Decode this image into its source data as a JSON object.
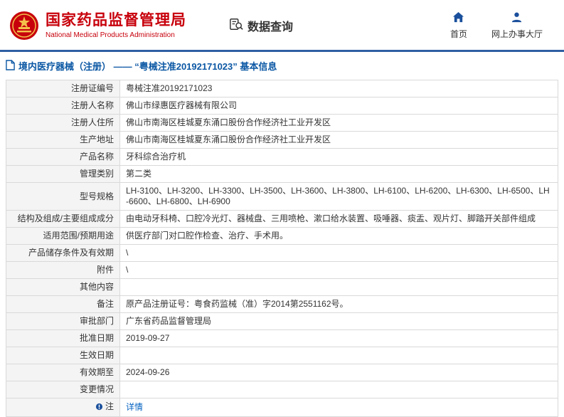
{
  "colors": {
    "brand_red": "#c7000b",
    "divider_blue": "#2e5fa3",
    "breadcrumb_blue": "#0b57a4",
    "link_blue": "#0563c1",
    "nav_icon_blue": "#1a4f9c"
  },
  "header": {
    "agency_name_cn": "国家药品监督管理局",
    "agency_name_en": "National Medical Products Administration",
    "section_title": "数据查询",
    "nav": [
      {
        "label": "首页",
        "icon": "home-icon"
      },
      {
        "label": "网上办事大厅",
        "icon": "person-icon"
      }
    ]
  },
  "breadcrumb": {
    "text": "境内医疗器械（注册） —— “粤械注准20192171023” 基本信息"
  },
  "table": {
    "rows": [
      {
        "label": "注册证编号",
        "value": "粤械注准20192171023"
      },
      {
        "label": "注册人名称",
        "value": "佛山市绿惠医疗器械有限公司"
      },
      {
        "label": "注册人住所",
        "value": "佛山市南海区桂城夏东涌口股份合作经济社工业开发区"
      },
      {
        "label": "生产地址",
        "value": "佛山市南海区桂城夏东涌口股份合作经济社工业开发区"
      },
      {
        "label": "产品名称",
        "value": "牙科综合治疗机"
      },
      {
        "label": "管理类别",
        "value": "第二类"
      },
      {
        "label": "型号规格",
        "value": "LH-3100、LH-3200、LH-3300、LH-3500、LH-3600、LH-3800、LH-6100、LH-6200、LH-6300、LH-6500、LH-6600、LH-6800、LH-6900"
      },
      {
        "label": "结构及组成/主要组成成分",
        "value": "由电动牙科椅、口腔冷光灯、器械盘、三用喷枪、漱口给水装置、吸唾器、痰盂、观片灯、脚踏开关部件组成"
      },
      {
        "label": "适用范围/预期用途",
        "value": "供医疗部门对口腔作检查、治疗、手术用。"
      },
      {
        "label": "产品储存条件及有效期",
        "value": "\\"
      },
      {
        "label": "附件",
        "value": "\\"
      },
      {
        "label": "其他内容",
        "value": ""
      },
      {
        "label": "备注",
        "value": "原产品注册证号：粤食药监械（准）字2014第2551162号。"
      },
      {
        "label": "审批部门",
        "value": "广东省药品监督管理局"
      },
      {
        "label": "批准日期",
        "value": "2019-09-27"
      },
      {
        "label": "生效日期",
        "value": ""
      },
      {
        "label": "有效期至",
        "value": "2024-09-26"
      },
      {
        "label": "变更情况",
        "value": ""
      },
      {
        "label": "注",
        "value": "详情"
      }
    ]
  }
}
